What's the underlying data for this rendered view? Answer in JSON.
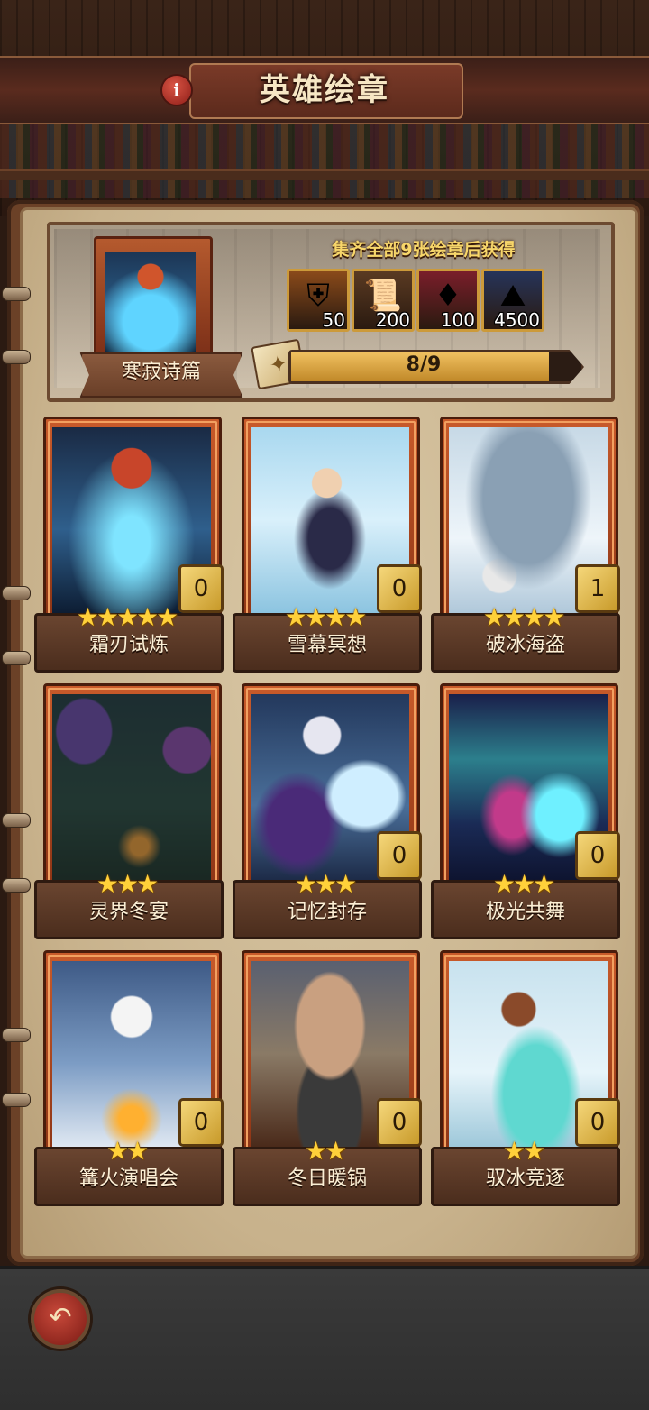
{
  "header": {
    "title": "英雄绘章",
    "info_icon": "info-icon",
    "info_glyph": "i"
  },
  "reward": {
    "collection_name": "寒寂诗篇",
    "collect_text": "集齐全部9张绘章后获得",
    "items": [
      {
        "icon": "armor-chest-icon",
        "glyph": "⛨",
        "quantity": "50",
        "bg": "#8a4a1a"
      },
      {
        "icon": "scroll-icon",
        "glyph": "📜",
        "quantity": "200",
        "bg": "#5a3a22"
      },
      {
        "icon": "red-gem-icon",
        "glyph": "♦",
        "quantity": "100",
        "bg": "#7a1e2a"
      },
      {
        "icon": "ore-pile-icon",
        "glyph": "⛰",
        "quantity": "4500",
        "bg": "#26345a"
      }
    ],
    "progress": {
      "text": "8/9",
      "current": 8,
      "total": 9
    },
    "progress_icon": "card-stack-icon"
  },
  "cards": [
    {
      "name": "霜刃试炼",
      "stars": "★★★★★",
      "count": "0",
      "locked": false,
      "art": "frost-blade-warrior"
    },
    {
      "name": "雪幕冥想",
      "stars": "★★★★",
      "count": "0",
      "locked": false,
      "art": "ice-witch"
    },
    {
      "name": "破冰海盗",
      "stars": "★★★★",
      "count": "1",
      "locked": false,
      "art": "frozen-pirate-ship"
    },
    {
      "name": "灵界冬宴",
      "stars": "★★★",
      "count": "",
      "locked": true,
      "art": "mushroom-feast"
    },
    {
      "name": "记忆封存",
      "stars": "★★★",
      "count": "0",
      "locked": false,
      "art": "ice-elf-sorceress"
    },
    {
      "name": "极光共舞",
      "stars": "★★★",
      "count": "0",
      "locked": false,
      "art": "aurora-dancer"
    },
    {
      "name": "篝火演唱会",
      "stars": "★★",
      "count": "0",
      "locked": false,
      "art": "skeleton-bard"
    },
    {
      "name": "冬日暖锅",
      "stars": "★★",
      "count": "0",
      "locked": false,
      "art": "cave-hotpot"
    },
    {
      "name": "驭冰竞逐",
      "stars": "★★",
      "count": "0",
      "locked": false,
      "art": "ice-wolf-rider"
    }
  ],
  "colors": {
    "frame": "#c85a2a",
    "label_bg": "#5a3a28",
    "star": "#ffd13a",
    "progress_fill": "#e0aa40"
  },
  "footer": {
    "back_glyph": "↶"
  }
}
